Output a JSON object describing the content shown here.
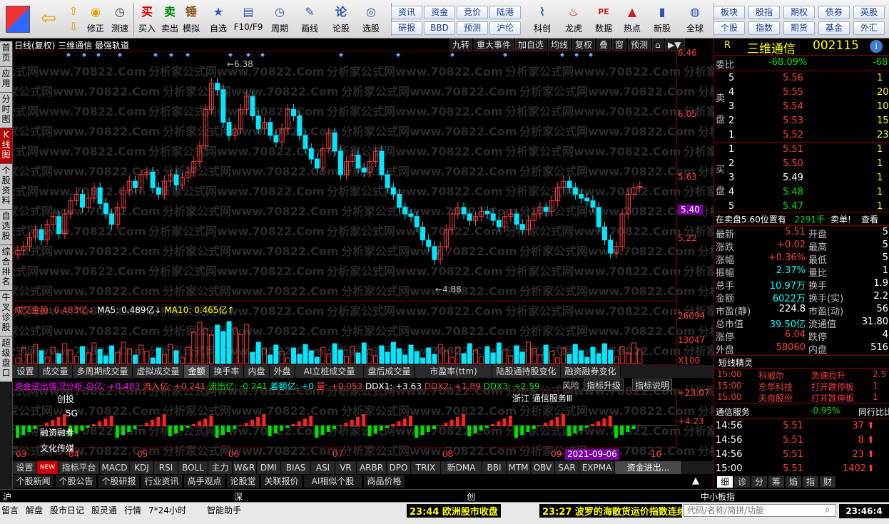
{
  "toolbar": {
    "buttons": [
      {
        "key": "buy",
        "label": "买入",
        "icon": "买",
        "color": "#d00000"
      },
      {
        "key": "sell",
        "label": "卖出",
        "icon": "卖",
        "color": "#008800"
      },
      {
        "key": "sim",
        "label": "模拟",
        "icon": "锤",
        "color": "#8a4b12"
      },
      {
        "key": "watch",
        "label": "自选",
        "icon": "★",
        "color": "#2a55b0"
      },
      {
        "key": "f10",
        "label": "F10/F9",
        "icon": "▤",
        "color": "#2a55b0"
      },
      {
        "key": "period",
        "label": "周期",
        "icon": "◷",
        "color": "#2a55b0"
      },
      {
        "key": "draw",
        "label": "画线",
        "icon": "✎",
        "color": "#2a55b0"
      },
      {
        "key": "lungu",
        "label": "论股",
        "icon": "论",
        "color": "#2a55b0"
      },
      {
        "key": "pick",
        "label": "选股",
        "icon": "◎",
        "color": "#2a55b0"
      },
      {
        "key": "kechuang",
        "label": "科创",
        "icon": "⌇",
        "color": "#2a55b0"
      },
      {
        "key": "longhu",
        "label": "龙虎",
        "icon": "♨",
        "color": "#cc2222"
      },
      {
        "key": "data",
        "label": "数据",
        "icon": "PE",
        "color": "#cc2222"
      },
      {
        "key": "hot",
        "label": "热点",
        "icon": "▲",
        "color": "#cc2222"
      },
      {
        "key": "newstock",
        "label": "新股",
        "icon": "▮",
        "color": "#2a55b0"
      },
      {
        "key": "global",
        "label": "全球",
        "icon": "◍",
        "color": "#2a55b0"
      }
    ],
    "fixit_label": "修正",
    "backtest_label": "测速",
    "links_row1": [
      "资讯",
      "资金",
      "竞价",
      "陆港"
    ],
    "links_row2": [
      "研报",
      "BBD",
      "预测",
      "沪伦"
    ],
    "links_row3": [
      "板块",
      "股指",
      "期权",
      "债券",
      "英股"
    ],
    "links_row4": [
      "个股",
      "指数",
      "期货",
      "基金",
      "外汇"
    ]
  },
  "left_tabs": [
    "首页",
    "应用",
    "分时图",
    "K线图",
    "个股资料",
    "自选股",
    "综合排名",
    "牛叉诊股",
    "超级盘口"
  ],
  "chart": {
    "title": "日线(复权) 三维通信 最强轨道",
    "header_buttons": [
      "九转",
      "重大事件",
      "加自选",
      "均线",
      "复权",
      "叠",
      "窗",
      "预测"
    ],
    "price_axis": [
      "6.46",
      "6.05",
      "5.63",
      "5.40",
      "5.22"
    ],
    "high_label": "6.38",
    "low_label": "4.88",
    "vol_title": "成交金额: 0.483亿↓",
    "vol_ma5": "MA5: 0.489亿↓",
    "vol_ma10": "MA10: 0.465亿↑",
    "vol_axis": [
      "26094",
      "13047",
      "X100"
    ],
    "vol_tabs": [
      "设置",
      "成交量",
      "多周期成交量",
      "虚拟成交量",
      "金额",
      "换手率",
      "内盘",
      "外盘",
      "AI立桩成交量",
      "盘后成交量",
      "市盈率(ttm)",
      "陆股通持股变化",
      "融资融券变化"
    ],
    "flow_title": "资金进出情况分析",
    "flow_total": "总亿: +0.483",
    "flow_in": "流入亿: +0.241",
    "flow_out": "流出亿: -0.241",
    "flow_diff": "差额亿: +0",
    "flow_qty": "量: +0.053",
    "ddx1": "DDX1: +3.63",
    "ddx2": "DDX2: +1.89",
    "ddx3": "DDX3: +2.59",
    "flow_btns": [
      "风险",
      "指标升级",
      "指标说明"
    ],
    "flow_axis": [
      "+23.07",
      "+4.23"
    ],
    "flow_notes": [
      "创投",
      "5G",
      "融资融券",
      "文化传媒",
      "浙江 通信服务Ⅲ"
    ],
    "months": [
      "03",
      "04",
      "05",
      "06",
      "07",
      "08",
      "09",
      "10"
    ],
    "date_cursor": "2021-09-06",
    "ind_tabs": [
      "设置",
      "指标平台",
      "MACD",
      "KDJ",
      "RSI",
      "BOLL",
      "主力",
      "W&R",
      "DMI",
      "BIAS",
      "ASI",
      "VR",
      "ARBR",
      "DPO",
      "TRIX",
      "新DMA",
      "BBI",
      "MTM",
      "OBV",
      "SAR",
      "EXPMA",
      "资金进出..."
    ],
    "new_badge": "NEW",
    "news_tabs": [
      "个股新闻",
      "个股公告",
      "个股研报",
      "行业资讯",
      "高手观点",
      "论股堂",
      "关联报价",
      "AI相似个股",
      "商品价格"
    ],
    "watermark": "分析家公式网www.70822.Com"
  },
  "quote": {
    "name": "三维通信",
    "code": "002115",
    "flag": "R",
    "wb_label": "委比",
    "wb_val": "-68.09%",
    "wb_diff": "-68",
    "sell_label": "卖盘",
    "buy_label": "买盘",
    "asks": [
      {
        "lv": "5",
        "p": "5.56",
        "v": "1"
      },
      {
        "lv": "4",
        "p": "5.55",
        "v": "20"
      },
      {
        "lv": "3",
        "p": "5.54",
        "v": "10"
      },
      {
        "lv": "2",
        "p": "5.53",
        "v": "15"
      },
      {
        "lv": "1",
        "p": "5.52",
        "v": "23"
      }
    ],
    "bids": [
      {
        "lv": "1",
        "p": "5.51",
        "v": "1"
      },
      {
        "lv": "2",
        "p": "5.50",
        "v": "1"
      },
      {
        "lv": "3",
        "p": "5.49",
        "v": "1"
      },
      {
        "lv": "4",
        "p": "5.48",
        "v": "1"
      },
      {
        "lv": "5",
        "p": "5.47",
        "v": "1"
      }
    ],
    "notice": "在卖盘5.60位置有",
    "notice_qty": "2291手",
    "notice_tag": "卖单!",
    "notice_link": "查看",
    "stats": [
      {
        "k1": "最新",
        "v1": "5.51",
        "c1": "red",
        "k2": "开盘",
        "v2": "5"
      },
      {
        "k1": "涨跌",
        "v1": "+0.02",
        "c1": "red",
        "k2": "最高",
        "v2": "5"
      },
      {
        "k1": "涨幅",
        "v1": "+0.36%",
        "c1": "red",
        "k2": "最低",
        "v2": "5"
      },
      {
        "k1": "振幅",
        "v1": "2.37%",
        "c1": "cyn",
        "k2": "量比",
        "v2": "1"
      },
      {
        "k1": "总手",
        "v1": "10.97万",
        "c1": "cyn",
        "k2": "换手",
        "v2": "1.9"
      },
      {
        "k1": "金额",
        "v1": "6022万",
        "c1": "cyn",
        "k2": "换手(实)",
        "v2": "2.2"
      },
      {
        "k1": "市盈(静)",
        "v1": "224.8",
        "c1": "wht",
        "k2": "市盈(动)",
        "v2": "56"
      },
      {
        "k1": "总市值",
        "v1": "39.50亿",
        "c1": "cyn",
        "k2": "流通值",
        "v2": "31.80"
      },
      {
        "k1": "涨停",
        "v1": "6.04",
        "c1": "red",
        "k2": "跌停",
        "v2": "4"
      },
      {
        "k1": "外盘",
        "v1": "58060",
        "c1": "red",
        "k2": "内盘",
        "v2": "516"
      }
    ],
    "elf_title": "短线精灵",
    "elf": [
      {
        "t": "15:00",
        "n": "科威尔",
        "e": "急速拉升",
        "v": "2.5"
      },
      {
        "t": "15:00",
        "n": "东华科技",
        "e": "打开跌停板",
        "v": "1"
      },
      {
        "t": "15:00",
        "n": "天奇股份",
        "e": "打开跌停板",
        "v": "1"
      }
    ],
    "sector": "通信服务",
    "sector_chg": "-0.95%",
    "sector_link": "同行比比",
    "ticks": [
      {
        "t": "14:56",
        "p": "5.51",
        "v": "37"
      },
      {
        "t": "14:56",
        "p": "5.51",
        "v": "8"
      },
      {
        "t": "14:56",
        "p": "5.51",
        "v": "23"
      },
      {
        "t": "15:00",
        "p": "5.51",
        "v": "1402"
      }
    ],
    "rtabs": [
      "细",
      "诊",
      "分",
      "筹",
      "焰",
      "指",
      "财"
    ]
  },
  "status": {
    "idx": [
      "沪",
      "深",
      "创",
      "中小板指"
    ],
    "bottom": [
      "留言",
      "解盘",
      "股市日记",
      "股灵通",
      "行情",
      "7*24小时",
      "智能助手"
    ],
    "news1": "23:44 欧洲股市收盘",
    "news2": "23:27 波罗的海散货运价指数连续",
    "search_placeholder": "代码/名称/简拼/功能",
    "clock": "23:46:4"
  },
  "chart_data": {
    "type": "candlestick",
    "x": [
      "03",
      "04",
      "05",
      "06",
      "07",
      "08",
      "09",
      "10"
    ],
    "y_range": [
      4.7,
      6.5
    ],
    "high": 6.38,
    "low": 4.88,
    "last": 5.51
  }
}
